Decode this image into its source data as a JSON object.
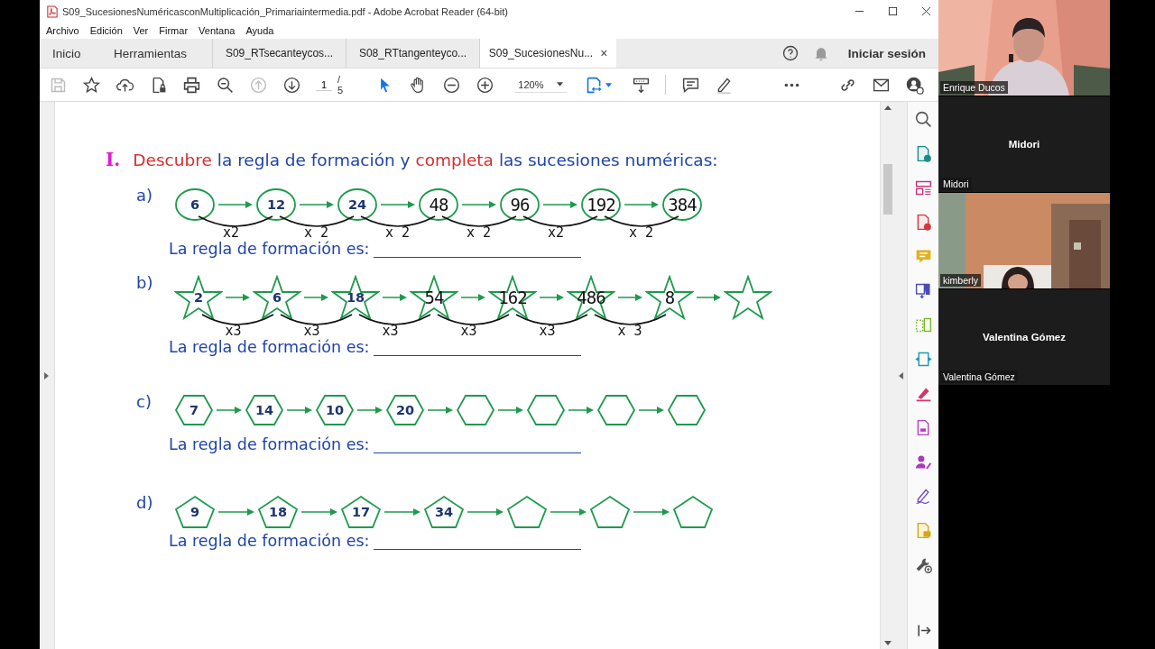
{
  "window": {
    "title": "S09_SucesionesNuméricasconMultiplicación_Primariaintermedia.pdf - Adobe Acrobat Reader (64-bit)"
  },
  "menu": [
    "Archivo",
    "Edición",
    "Ver",
    "Firmar",
    "Ventana",
    "Ayuda"
  ],
  "tabs": [
    {
      "label": "Inicio",
      "kind": "nav",
      "selected": false
    },
    {
      "label": "Herramientas",
      "kind": "nav",
      "selected": false
    },
    {
      "label": "S09_RTsecanteycos...",
      "kind": "doc",
      "selected": false
    },
    {
      "label": "S08_RTtangenteyco...",
      "kind": "doc",
      "selected": false
    },
    {
      "label": "S09_SucesionesNu...",
      "kind": "doc",
      "selected": true,
      "close": "×"
    }
  ],
  "sign_in": "Iniciar sesión",
  "toolbar": {
    "page": "1",
    "pages": "/ 5",
    "zoom": "120%"
  },
  "document": {
    "numeral": "I.",
    "heading": [
      {
        "text": "Descubre",
        "color": "#d42f2f"
      },
      {
        "text": "la regla de formación y",
        "color": "#1f44a8"
      },
      {
        "text": "completa",
        "color": "#d42f2f"
      },
      {
        "text": "las sucesiones numéricas:",
        "color": "#1f44a8"
      }
    ],
    "sequences": [
      {
        "letter": "a)",
        "kind": "circle",
        "nodes": [
          {
            "value": "6",
            "kind": "printed"
          },
          {
            "value": "12",
            "kind": "printed"
          },
          {
            "value": "24",
            "kind": "printed"
          },
          {
            "value": "48",
            "kind": "handwritten"
          },
          {
            "value": "96",
            "kind": "handwritten"
          },
          {
            "value": "192",
            "kind": "handwritten"
          },
          {
            "value": "384",
            "kind": "handwritten"
          }
        ],
        "multipliers": [
          "x2",
          "x 2",
          "x 2",
          "x 2",
          "x2",
          "x 2"
        ],
        "rule_label": "La regla de formación es:"
      },
      {
        "letter": "b)",
        "kind": "star",
        "nodes": [
          {
            "value": "2",
            "kind": "printed"
          },
          {
            "value": "6",
            "kind": "printed"
          },
          {
            "value": "18",
            "kind": "printed"
          },
          {
            "value": "54",
            "kind": "handwritten"
          },
          {
            "value": "162",
            "kind": "handwritten"
          },
          {
            "value": "486",
            "kind": "handwritten"
          },
          {
            "value": "8",
            "kind": "handwritten"
          },
          {
            "kind": "blank"
          }
        ],
        "multipliers": [
          "x3",
          "x3",
          "x3",
          "x3",
          "x3",
          "x 3"
        ],
        "rule_label": "La regla de formación es:"
      },
      {
        "letter": "c)",
        "kind": "hexagon",
        "nodes": [
          {
            "value": "7",
            "kind": "printed"
          },
          {
            "value": "14",
            "kind": "printed"
          },
          {
            "value": "10",
            "kind": "printed"
          },
          {
            "value": "20",
            "kind": "printed"
          },
          {
            "kind": "blank"
          },
          {
            "kind": "blank"
          },
          {
            "kind": "blank"
          },
          {
            "kind": "blank"
          }
        ],
        "rule_label": "La regla de formación es:"
      },
      {
        "letter": "d)",
        "kind": "pentagon",
        "nodes": [
          {
            "value": "9",
            "kind": "printed"
          },
          {
            "value": "18",
            "kind": "printed"
          },
          {
            "value": "17",
            "kind": "printed"
          },
          {
            "value": "34",
            "kind": "printed"
          },
          {
            "kind": "blank"
          },
          {
            "kind": "blank"
          },
          {
            "kind": "blank"
          }
        ],
        "rule_label": "La regla de formación es:"
      }
    ]
  },
  "participants": [
    {
      "label": "Enrique Ducos",
      "video": true
    },
    {
      "label": "Midori",
      "title": "Midori",
      "video": false
    },
    {
      "label": "kimberly",
      "video": true
    },
    {
      "label": "Valentina Gómez",
      "title": "Valentina Gómez",
      "video": false
    }
  ]
}
